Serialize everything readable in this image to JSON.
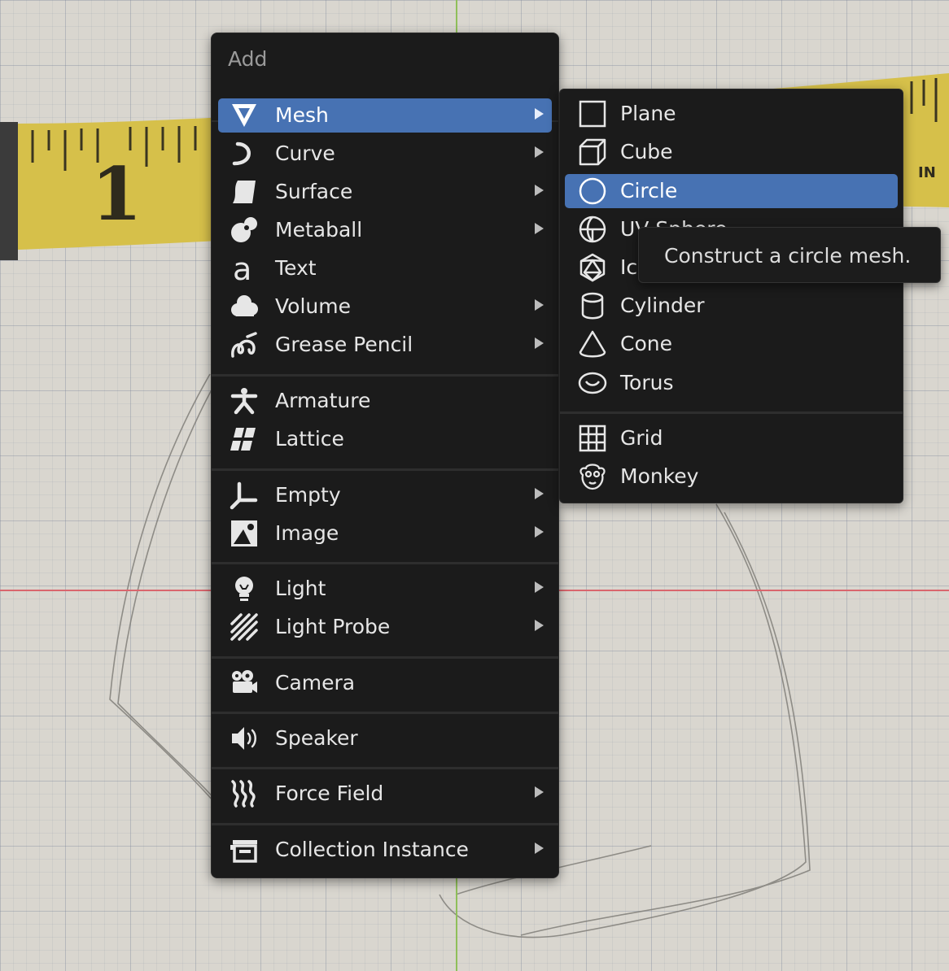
{
  "menu": {
    "title": "Add",
    "items": [
      {
        "label": "Mesh",
        "icon": "mesh-icon",
        "submenu": true,
        "active": true
      },
      {
        "label": "Curve",
        "icon": "curve-icon",
        "submenu": true
      },
      {
        "label": "Surface",
        "icon": "surface-icon",
        "submenu": true
      },
      {
        "label": "Metaball",
        "icon": "metaball-icon",
        "submenu": true
      },
      {
        "label": "Text",
        "icon": "text-icon",
        "submenu": false
      },
      {
        "label": "Volume",
        "icon": "volume-icon",
        "submenu": true
      },
      {
        "label": "Grease Pencil",
        "icon": "grease-pencil-icon",
        "submenu": true
      },
      {
        "label": "Armature",
        "icon": "armature-icon",
        "submenu": false
      },
      {
        "label": "Lattice",
        "icon": "lattice-icon",
        "submenu": false
      },
      {
        "label": "Empty",
        "icon": "empty-icon",
        "submenu": true
      },
      {
        "label": "Image",
        "icon": "image-icon",
        "submenu": true
      },
      {
        "label": "Light",
        "icon": "light-icon",
        "submenu": true
      },
      {
        "label": "Light Probe",
        "icon": "light-probe-icon",
        "submenu": true
      },
      {
        "label": "Camera",
        "icon": "camera-icon",
        "submenu": false
      },
      {
        "label": "Speaker",
        "icon": "speaker-icon",
        "submenu": false
      },
      {
        "label": "Force Field",
        "icon": "force-field-icon",
        "submenu": true
      },
      {
        "label": "Collection Instance",
        "icon": "collection-instance-icon",
        "submenu": true
      }
    ]
  },
  "submenu": {
    "items": [
      {
        "label": "Plane",
        "icon": "plane-icon"
      },
      {
        "label": "Cube",
        "icon": "cube-icon"
      },
      {
        "label": "Circle",
        "icon": "circle-icon",
        "active": true
      },
      {
        "label": "UV Sphere",
        "icon": "uv-sphere-icon"
      },
      {
        "label": "Ico Sphere",
        "icon": "ico-sphere-icon"
      },
      {
        "label": "Cylinder",
        "icon": "cylinder-icon"
      },
      {
        "label": "Cone",
        "icon": "cone-icon"
      },
      {
        "label": "Torus",
        "icon": "torus-icon"
      },
      {
        "label": "Grid",
        "icon": "grid-icon"
      },
      {
        "label": "Monkey",
        "icon": "monkey-icon"
      }
    ]
  },
  "tooltip": {
    "text": "Construct a circle mesh."
  },
  "viewport": {
    "tape_label": "IN",
    "tape_number": "1",
    "colors": {
      "menu_bg": "#1b1b1b",
      "highlight": "#4772b3",
      "tape": "#d9c34a",
      "x_axis": "#d9666e",
      "y_axis": "#8fbf5a"
    }
  }
}
